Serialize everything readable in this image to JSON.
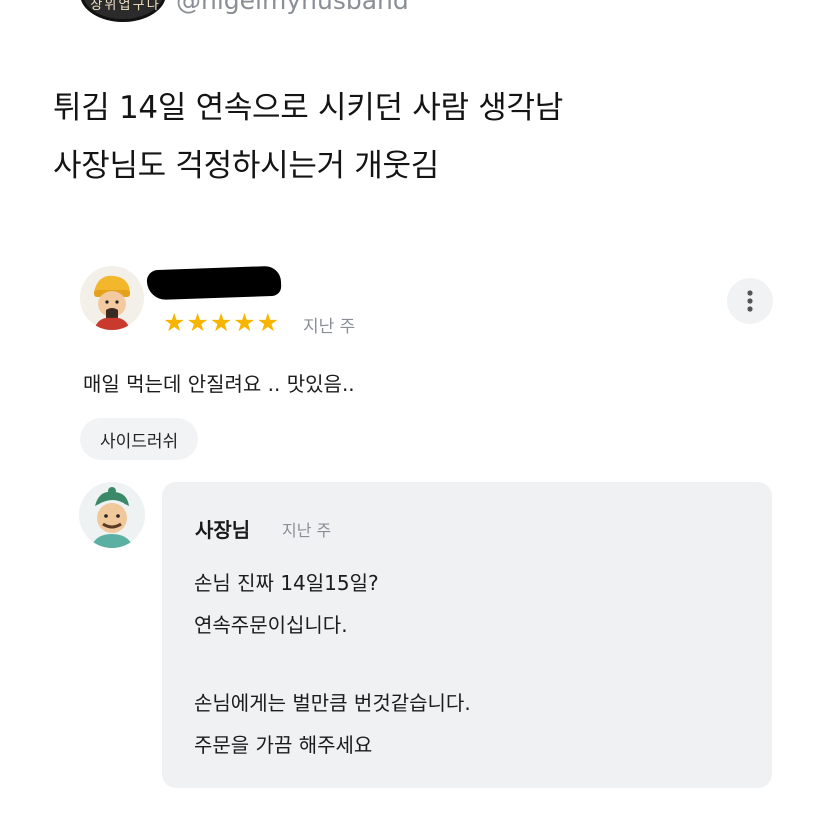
{
  "tweet": {
    "avatar_text": "상 위 업 구 나",
    "handle": "@nigelmyhusband",
    "line1": "튀김 14일 연속으로 시키던 사람 생각남",
    "line2": "사장님도 걱정하시는거 개웃김"
  },
  "review": {
    "stars": "★★★★★",
    "rating": 5,
    "time": "지난 주",
    "text": "매일 먹는데 안질려요 .. 맛있음..",
    "tag": "사이드러쉬",
    "colors": {
      "star": "#f7b500",
      "chip_bg": "#f2f3f5",
      "reply_bg": "#f0f1f3"
    }
  },
  "reply": {
    "name": "사장님",
    "time": "지난 주",
    "line1": "손님 진짜 14일15일?",
    "line2": "연속주문이십니다.",
    "line3": "손님에게는 벌만큼 번것같습니다.",
    "line4": "주문을 가끔 해주세요"
  },
  "icons": {
    "more": "more-vertical-icon",
    "reviewer_avatar": "reviewer-avatar-icon",
    "owner_avatar": "owner-avatar-icon"
  }
}
